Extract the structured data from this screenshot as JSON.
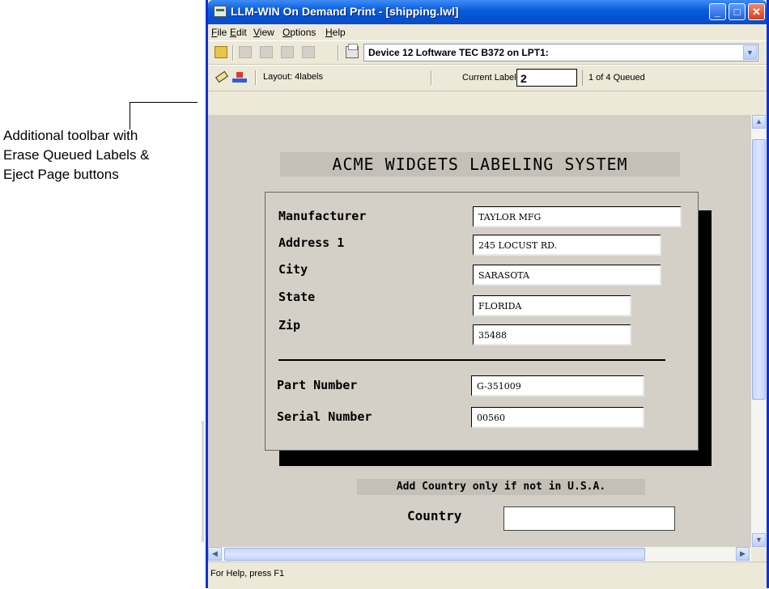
{
  "annotation": {
    "lines": [
      "Additional toolbar with",
      "Erase Queued Labels &",
      "Eject Page buttons"
    ]
  },
  "window": {
    "title": "LLM-WIN On Demand Print - [shipping.lwl]",
    "controls": {
      "minimize": "_",
      "maximize": "□",
      "close": "✕"
    }
  },
  "menu": [
    "File",
    "Edit",
    "View",
    "Options",
    "Help"
  ],
  "toolbar": {
    "device": "Device 12 Loftware TEC B372 on LPT1:",
    "icons": [
      "open-icon",
      "label-icon",
      "label-icon",
      "label-icon",
      "label-icon",
      "print-icon"
    ]
  },
  "toolbar2": {
    "icons": [
      "erase-queued-labels-icon",
      "eject-page-icon"
    ],
    "layout": "Layout:  4labels",
    "current_label_text": "Current Label:",
    "current_label_value": "2",
    "queued": "1 of 4 Queued"
  },
  "form": {
    "title": "ACME WIDGETS LABELING SYSTEM",
    "fields": [
      {
        "label": "Manufacturer",
        "value": "TAYLOR MFG"
      },
      {
        "label": "Address 1",
        "value": "245 LOCUST RD."
      },
      {
        "label": "City",
        "value": "SARASOTA"
      },
      {
        "label": "State",
        "value": "FLORIDA"
      },
      {
        "label": "Zip",
        "value": "35488"
      },
      {
        "label": "Part Number",
        "value": "G-351009"
      },
      {
        "label": "Serial Number",
        "value": "00560"
      }
    ],
    "hint": "Add Country only if not in U.S.A.",
    "country_label": "Country",
    "country_value": ""
  },
  "scroll": {
    "up": "▲",
    "down": "▼",
    "left": "◀",
    "right": "▶"
  },
  "status": "For Help, press F1"
}
